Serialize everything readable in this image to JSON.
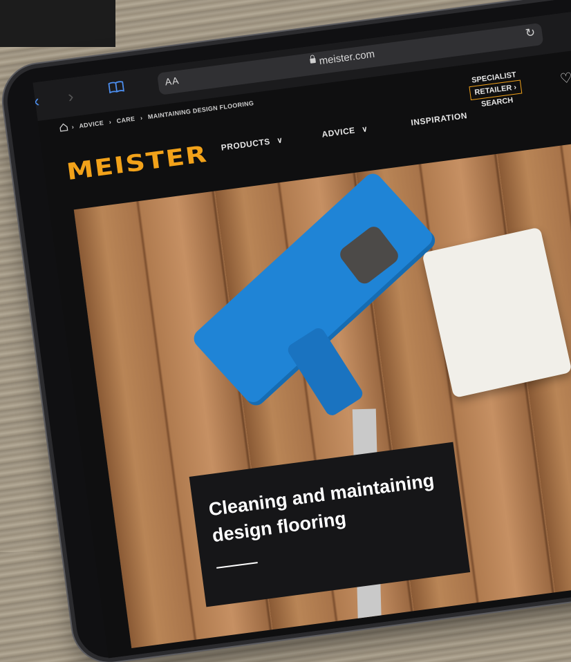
{
  "browser": {
    "url": "meister.com",
    "reader_label": "AA"
  },
  "breadcrumb": [
    "ADVICE",
    "CARE",
    "MAINTAINING DESIGN FLOORING"
  ],
  "brand": {
    "logo_text": "MEISTER",
    "accent_color": "#f2a21a"
  },
  "nav": {
    "products": "PRODUCTS",
    "advice": "ADVICE",
    "inspiration": "INSPIRATION",
    "retailer_line1": "SPECIALIST",
    "retailer_line2": "RETAILER",
    "retailer_line3": "SEARCH"
  },
  "hero": {
    "title": "Cleaning and maintaining design flooring"
  },
  "icons": [
    "back-icon",
    "forward-icon",
    "bookmarks-icon",
    "lock-icon",
    "reload-icon",
    "home-icon",
    "chevron-down-icon",
    "chevron-right-icon",
    "heart-icon"
  ]
}
